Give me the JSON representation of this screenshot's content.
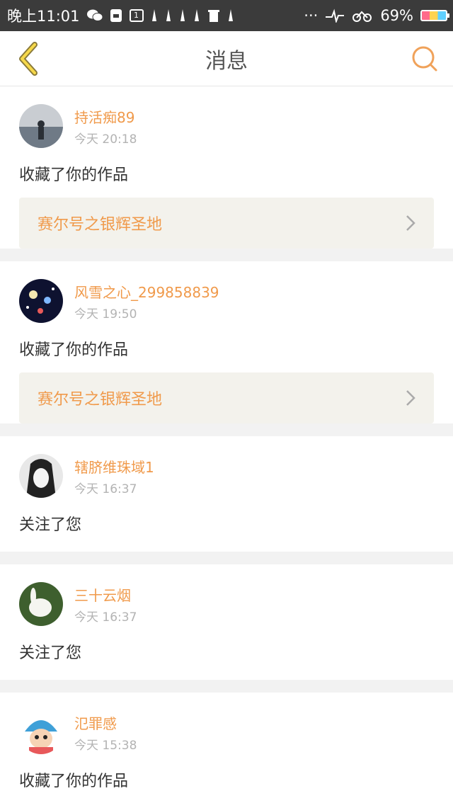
{
  "status_bar": {
    "time": "晚上11:01",
    "dots": "···",
    "battery": "69%"
  },
  "header": {
    "title": "消息",
    "back_icon": "chevron-left-icon",
    "search_icon": "search-icon",
    "accent": "#f09a4b"
  },
  "messages": [
    {
      "user": "持活痴89",
      "time": "今天 20:18",
      "action": "收藏了你的作品",
      "work": "赛尔号之银辉圣地"
    },
    {
      "user": "风雪之心_299858839",
      "time": "今天 19:50",
      "action": "收藏了你的作品",
      "work": "赛尔号之银辉圣地"
    },
    {
      "user": "辖脐维珠域1",
      "time": "今天 16:37",
      "action": "关注了您"
    },
    {
      "user": "三十云烟",
      "time": "今天 16:37",
      "action": "关注了您"
    },
    {
      "user": "氾罪感",
      "time": "今天 15:38",
      "action": "收藏了你的作品"
    }
  ]
}
